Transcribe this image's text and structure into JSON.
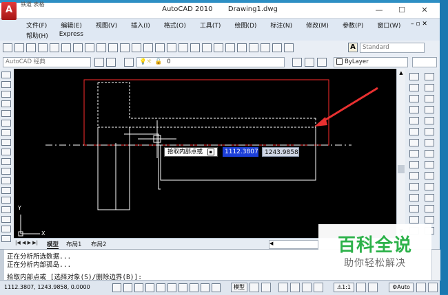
{
  "window": {
    "title": "AutoCAD 2010",
    "document": "Drawing1.dwg",
    "minimize": "—",
    "maximize": "☐",
    "close": "✕",
    "top_fragment": "铁道  表格"
  },
  "menu": {
    "items": [
      "文件(F)",
      "编辑(E)",
      "视图(V)",
      "插入(I)",
      "格式(O)",
      "工具(T)",
      "绘图(D)",
      "标注(N)",
      "修改(M)",
      "参数(P)",
      "窗口(W)"
    ],
    "items2": [
      "帮助(H)",
      "Express"
    ],
    "window_ctrls": "– ▫ ✕"
  },
  "toolbar": {
    "text_style": "Standard",
    "workspace": "AutoCAD 经典",
    "layer_value": "0",
    "color_value": "ByLayer"
  },
  "drawing": {
    "dyn_label": "拾取内部点或",
    "dyn_x": "1112.3807",
    "dyn_y": "1243.9858",
    "ucs_y": "Y",
    "ucs_x": "X",
    "accent": "#ff2020"
  },
  "tabs": {
    "model": "模型",
    "layout1": "布局1",
    "layout2": "布局2"
  },
  "command": {
    "line1": "正在分析所选数据...",
    "line2": "正在分析内部孤岛...",
    "line3": "拾取内部点或 [选择对象(S)/删除边界(B)]:"
  },
  "status": {
    "coords": "1112.3807, 1243.9858, 0.0000",
    "model_label": "模型",
    "scale_label": "1:1",
    "auto_label": "Auto"
  },
  "watermark": {
    "title": "百科全说",
    "subtitle": "助你轻松解决"
  }
}
